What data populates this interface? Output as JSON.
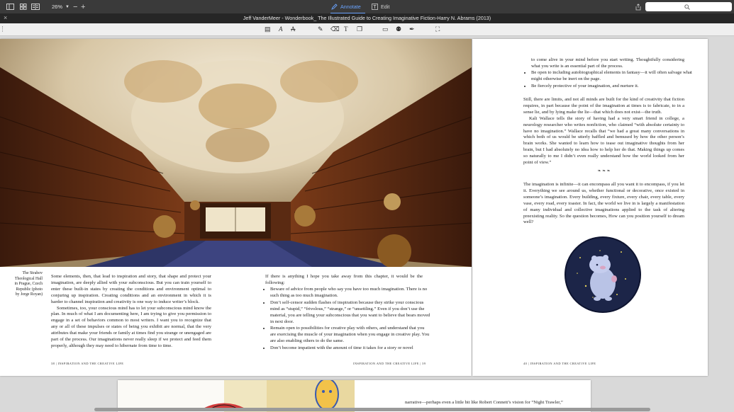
{
  "toolbar": {
    "zoom": "26%",
    "annotate_label": "Annotate",
    "edit_label": "Edit",
    "icons": [
      "sidebar-icon",
      "grid-icon",
      "layout-icon",
      "zoom-out-icon",
      "zoom-in-icon",
      "annotate-icon",
      "edit-icon",
      "share-icon",
      "search-icon"
    ]
  },
  "window": {
    "title": "Jeff VanderMeer - Wonderbook_ The Illustrated Guide to Creating Imaginative Fiction-Harry N. Abrams (2013)"
  },
  "annotation_tools": [
    "text-box-icon",
    "text-style-icon",
    "strikethrough-icon",
    "pen-icon",
    "eraser-icon",
    "text-icon",
    "shapes-icon",
    "comment-icon",
    "stamp-icon",
    "signature-icon",
    "crop-icon"
  ],
  "spread": {
    "caption": "The Strahov Theological Hall in Prague, Czech Republic (photo by Jorge Royan)",
    "left_col_para1": "Some elements, then, that lead to inspiration and story, that shape and protect your imagination, are deeply allied with your subconscious. But you can train yourself to enter these built-in states by creating the conditions and environment optimal to conjuring up inspiration. Creating conditions and an environment in which it is harder to channel inspiration and creativity is one way to induce writer’s block.",
    "left_col_para2": "Sometimes, too, your conscious mind has to let your subconscious mind know the plan. In much of what I am documenting here, I am trying to give you permission to engage in a set of behaviors common to most writers. I want you to recognize that any or all of these impulses or states of being you exhibit are normal, that the very attributes that make your friends or family at times find you strange or unengaged are part of the process. Our imaginations never really sleep if we protect and feed them properly, although they may need to hibernate from time to time.",
    "mid_intro": "If there is anything I hope you take away from this chapter, it would be the following:",
    "mid_bullets": [
      "Beware of advice from people who say you have too much imagination. There is no such thing as too much imagination.",
      "Don’t self-censor sudden flashes of inspiration because they strike your conscious mind as “stupid,” “frivolous,” “strange,” or “unsettling.” Even if you don’t use the material, you are telling your subconscious that you want to believe that bears moved in next door.",
      "Remain open to possibilities for creative play with others, and understand that you are exercising the muscle of your imagination when you engage in creative play. You are also enabling others to do the same.",
      "Don’t become impatient with the amount of time it takes for a story or novel"
    ],
    "footer_left": "38 | INSPIRATION AND THE CREATIVE LIFE",
    "footer_mid": "INSPIRATION AND THE CREATIVE LIFE | 39"
  },
  "right_page": {
    "bullet_cont": "to come alive in your mind before you start writing. Thoughtfully considering what you write is an essential part of the process.",
    "bullets": [
      "Be open to including autobiographical elements in fantasy—it will often salvage what might otherwise be inert on the page.",
      "Be fiercely protective of your imagination, and nurture it."
    ],
    "para1": "Still, there are limits, and not all minds are built for the kind of creativity that fiction requires, in part because the point of the imagination at times is to fabricate, to in a sense lie, and by lying make the lie—that which does not exist—the truth.",
    "para2": "Kali Wallace tells the story of having had a very smart friend in college, a neurology researcher who writes nonfiction, who claimed “with absolute certainty to have no imagination.” Wallace recalls that “we had a great many conversations in which both of us would be utterly baffled and bemused by how the other person’s brain works. She wanted to learn how to tease out imaginative thoughts from her brain, but I had absolutely no idea how to help her do that. Making things up comes so naturally to me I didn’t even really understand how the world looked from her point of view.”",
    "ornament": "❧ ❧ ❧",
    "para3": "The imagination is infinite—it can encompass all you want it to encompass, if you let it. Everything we see around us, whether functional or decorative, once existed in someone’s imagination. Every building, every fixture, every chair, every table, every vase, every road, every toaster. In fact, the world we live in is largely a manifestation of many individual and collective imaginations applied to the task of altering preexisting reality. So the question becomes, How can you position yourself to dream well?",
    "footer": "40 | INSPIRATION AND THE CREATIVE LIFE"
  },
  "next_page": {
    "text": "narrative—perhaps even a little bit like Robert Connett’s vision for “Night Trawler,”"
  },
  "colors": {
    "toolbar": "#3a3a3a",
    "titlebar": "#262626",
    "accent": "#6aa4ff",
    "canvas": "#d9d9d9"
  }
}
